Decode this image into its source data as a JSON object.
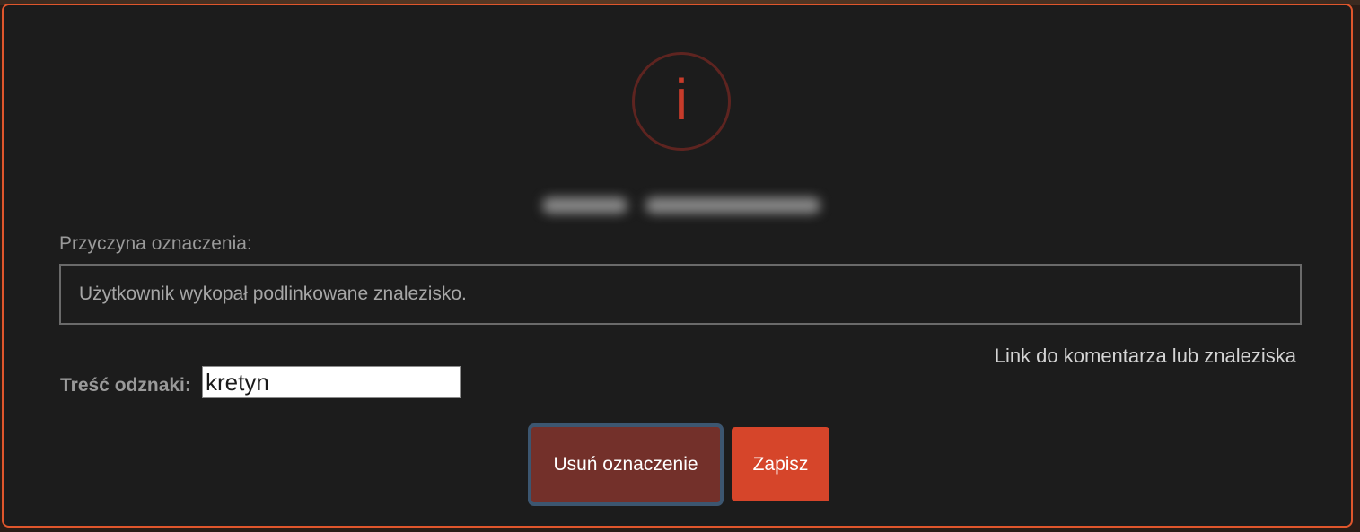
{
  "dialog": {
    "icon": "info-icon",
    "icon_glyph": "i",
    "colors": {
      "accent": "#e0562c",
      "icon": "#c63b2a",
      "remove_button": "#73302a",
      "save_button": "#d6452a"
    }
  },
  "reason": {
    "label": "Przyczyna oznaczenia:",
    "value": "Użytkownik wykopał podlinkowane znalezisko."
  },
  "link": {
    "label": "Link do komentarza lub znaleziska"
  },
  "badge": {
    "label": "Treść odznaki:",
    "value": "kretyn"
  },
  "buttons": {
    "remove_label": "Usuń oznaczenie",
    "save_label": "Zapisz"
  }
}
